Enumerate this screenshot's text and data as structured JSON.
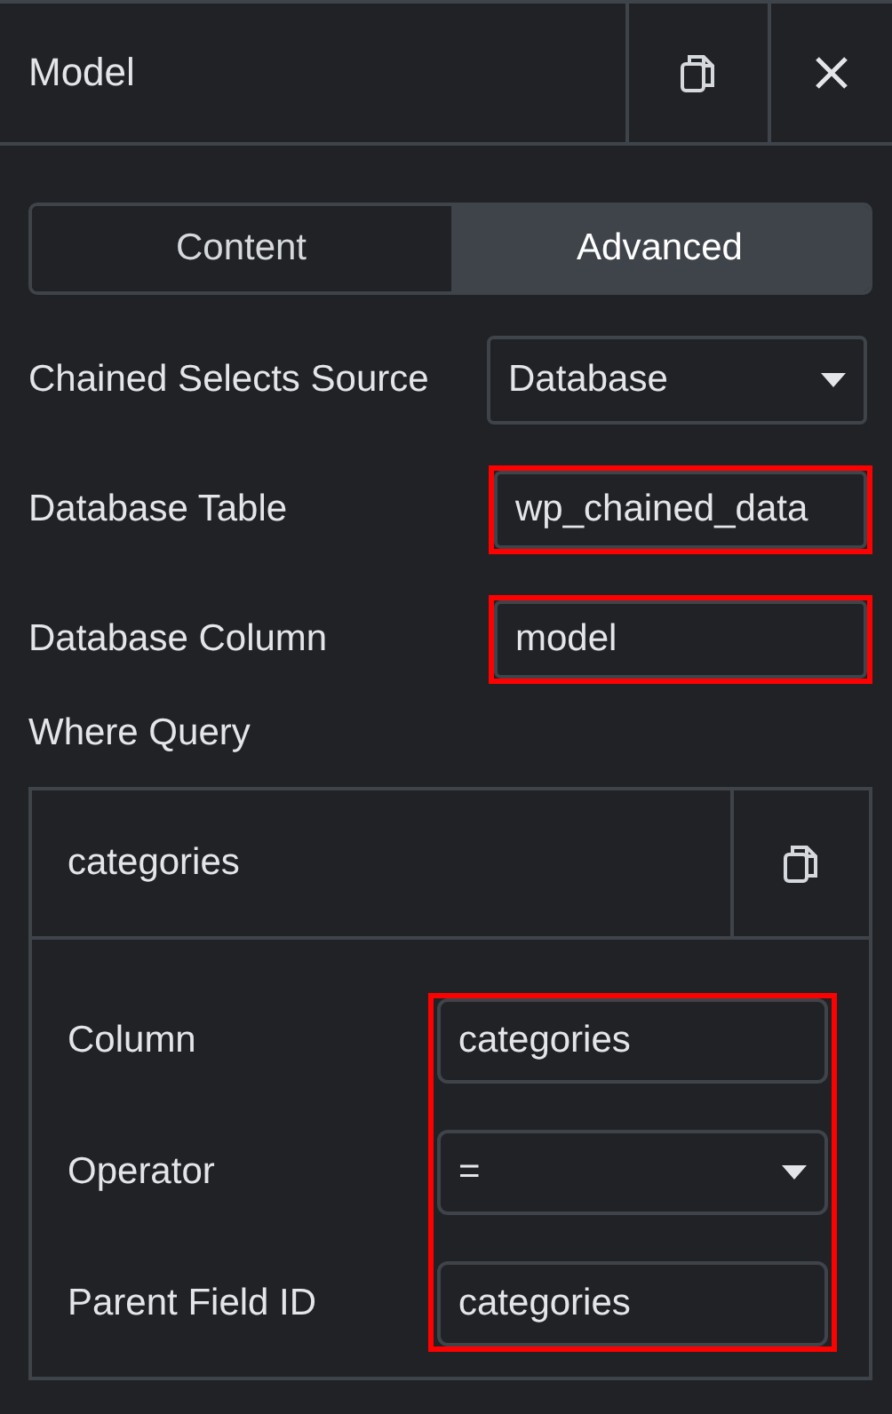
{
  "header": {
    "title": "Model"
  },
  "tabs": [
    {
      "label": "Content",
      "selected": false
    },
    {
      "label": "Advanced",
      "selected": true
    }
  ],
  "controls": [
    {
      "kind": "select",
      "label": "Chained Selects Source",
      "value": "Database",
      "highlighted": false
    },
    {
      "kind": "text",
      "label": "Database Table",
      "value": "wp_chained_data",
      "highlighted": true
    },
    {
      "kind": "text",
      "label": "Database Column",
      "value": "model",
      "highlighted": true
    }
  ],
  "where_query": {
    "label": "Where Query",
    "item": {
      "title": "categories",
      "highlighted": true,
      "fields": [
        {
          "kind": "text",
          "label": "Column",
          "value": "categories"
        },
        {
          "kind": "select",
          "label": "Operator",
          "value": "="
        },
        {
          "kind": "text",
          "label": "Parent Field ID",
          "value": "categories"
        }
      ]
    }
  }
}
